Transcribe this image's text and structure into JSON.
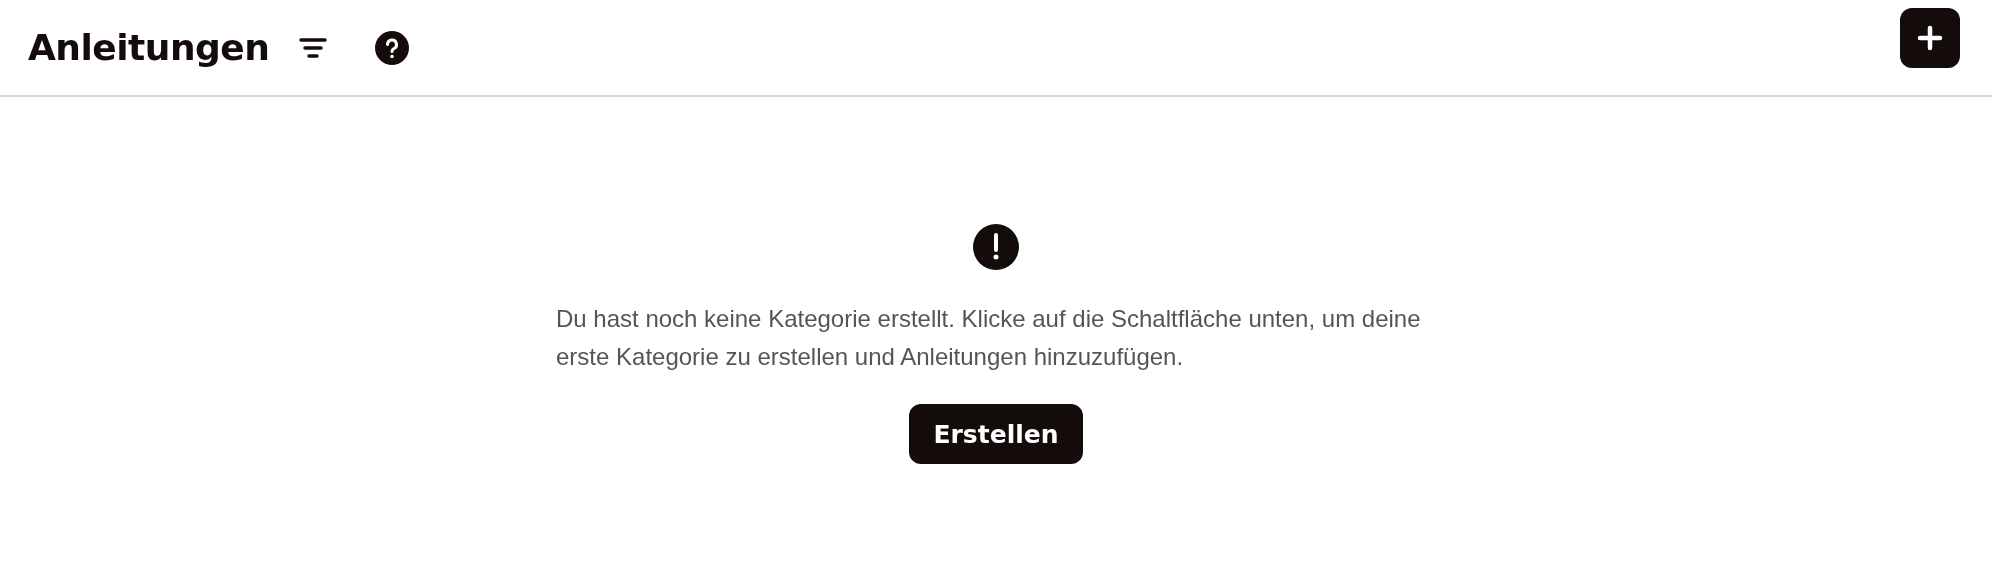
{
  "header": {
    "title": "Anleitungen"
  },
  "empty_state": {
    "message": "Du hast noch keine Kategorie erstellt. Klicke auf die Schaltfläche unten, um deine erste Kategorie zu erstellen und Anleitungen hinzuzufügen.",
    "button": "Erstellen"
  }
}
